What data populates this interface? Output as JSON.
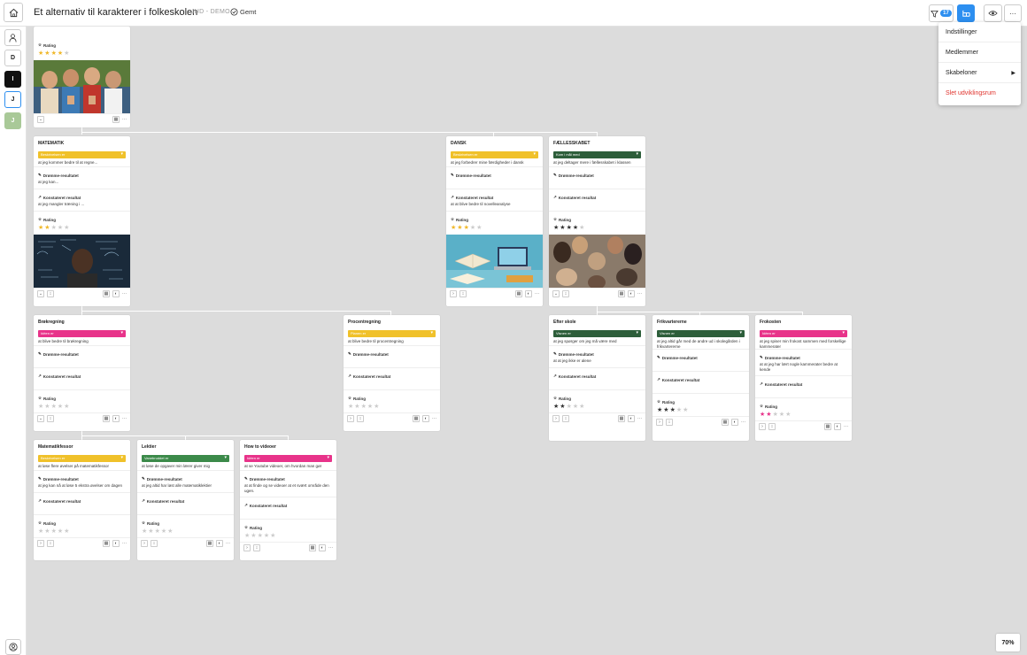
{
  "header": {
    "title": "Et alternativ til karakterer i folkeskolen",
    "subtitle": "JHD - DEMO",
    "saved": "Gemt",
    "filter_count": "17"
  },
  "sidebar": {
    "items": [
      "D",
      "I",
      "J",
      "J"
    ]
  },
  "menu": {
    "items": [
      "Indstillinger",
      "Medlemmer",
      "Skabeloner",
      "Slet udviklingsrum"
    ]
  },
  "zoom": "70%",
  "labels": {
    "rating": "Rating",
    "dream": "Drømme-resultatet",
    "confirmed": "Konstateret resultat"
  },
  "colors": {
    "accent": "#2d8ff0",
    "yellow": "#f0c12a",
    "green": "#2d5e3a",
    "pink": "#e8338a",
    "star": "#f0b82a",
    "star_dark": "#333",
    "star_empty": "#ccc"
  },
  "cards": {
    "root": {
      "rating": 4
    },
    "matematik": {
      "title": "MATEMATIK",
      "status": "Beskrivelsen er",
      "text": "at jeg kommer bedre til at regne...",
      "dream": "at jeg kan...",
      "confirmed": "at jeg mangler træning i ...",
      "rating": 2
    },
    "dansk": {
      "title": "DANSK",
      "status": "Beskrivelsen er",
      "text": "at jeg forbedrer mine færdigheder i dansk",
      "dream": "",
      "confirmed": "at at blive bedre til novelleanalyse",
      "rating": 3
    },
    "faellesskabet": {
      "title": "FÆLLESSKABET",
      "status": "Kom i mål med",
      "text": "at jeg deltager mere i fællesskabet i klassen",
      "dream": "",
      "confirmed": "",
      "rating": 4
    },
    "broekregning": {
      "title": "Brøkregning",
      "status": "Idéen er",
      "text": "at blive bedre til brøkregning",
      "dream": "",
      "confirmed": "",
      "rating": 0
    },
    "procentregning": {
      "title": "Procentregning",
      "status": "Planen er",
      "text": "at blive bedre til procentregning",
      "dream": "",
      "confirmed": "",
      "rating": 0
    },
    "efter_skole": {
      "title": "Efter skole",
      "status": "Visnen er",
      "text": "at jeg spørger om jeg må være med",
      "dream": "at at jeg ikke er alene",
      "confirmed": "",
      "rating": 2
    },
    "frikvartererne": {
      "title": "Frikvartererne",
      "status": "Visnen er",
      "text": "at jeg altid går med de andre ud i skolegården i frikvartererne",
      "dream": "",
      "confirmed": "",
      "rating": 3
    },
    "frokosten": {
      "title": "Frokosten",
      "status": "Idéen er",
      "text": "at jeg spiser min frokost sammen med forskellige kammerater",
      "dream": "at at jeg har lært nogle kammerater bedre at kende",
      "confirmed": "",
      "rating": 2
    },
    "matematikfessor": {
      "title": "Matematikfessor",
      "status": "Beskrivelsen er",
      "text": "at løse flere øvelser på matematikfessor",
      "dream": "at jeg kan nå at løse 5 ekstra øvelser om dagen",
      "confirmed": "",
      "rating": 0
    },
    "lektier": {
      "title": "Lektier",
      "status": "Vanebruddet er",
      "text": "at løse de opgaver min lærer giver mig",
      "dream": "at jeg altid har løst alle matematiklektier",
      "confirmed": "",
      "rating": 0
    },
    "how_to": {
      "title": "How to videoer",
      "status": "Idéen er",
      "text": "at se Youtube videoer, om hvordan man gør",
      "dream": "at at finde og se videoer at et svært område den ugen.",
      "confirmed": "",
      "rating": 0
    }
  }
}
